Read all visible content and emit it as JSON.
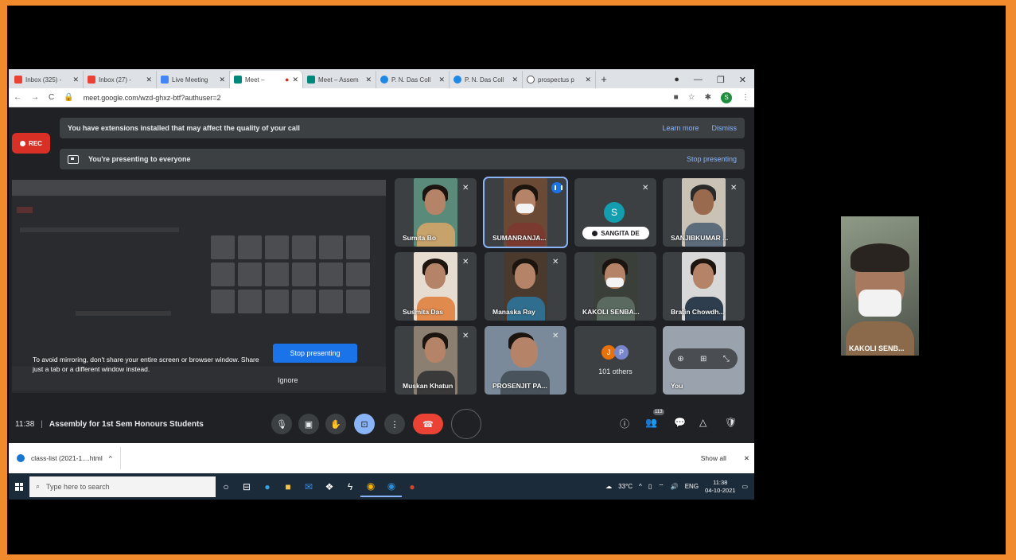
{
  "tabs": [
    {
      "label": "Inbox (325) -",
      "icon": "gmail-icon",
      "color": "#ea4335"
    },
    {
      "label": "Inbox (27) -",
      "icon": "gmail-icon",
      "color": "#ea4335"
    },
    {
      "label": "Live Meeting",
      "icon": "calendar-icon",
      "color": "#4285f4"
    },
    {
      "label": "Meet –",
      "icon": "meet-icon",
      "color": "#00897b",
      "active": true
    },
    {
      "label": "Meet – Assem",
      "icon": "meet-icon",
      "color": "#00897b"
    },
    {
      "label": "P. N. Das Coll",
      "icon": "site-icon",
      "color": "#1e88e5"
    },
    {
      "label": "P. N. Das Coll",
      "icon": "site-icon",
      "color": "#1e88e5"
    },
    {
      "label": "prospectus p",
      "icon": "globe-icon",
      "color": "#555555"
    }
  ],
  "browser": {
    "url": "meet.google.com/wzd-ghxz-btf?authuser=2",
    "profile_initial": "S"
  },
  "recording_label": "REC",
  "extension_banner": {
    "text": "You have extensions installed that may affect the quality of your call",
    "learn_more": "Learn more",
    "dismiss": "Dismiss"
  },
  "presenting_banner": {
    "text": "You're presenting to everyone",
    "stop": "Stop presenting"
  },
  "mirror_warning": {
    "text": "To avoid mirroring, don't share your entire screen or browser window. Share just a tab or a different window instead.",
    "stop_button": "Stop presenting",
    "ignore": "Ignore"
  },
  "participants": [
    {
      "name": "Sumita Bo",
      "muted": true,
      "bg": "#5a8a7a",
      "body": "#c7a26a"
    },
    {
      "name": "SUMANRANJA...",
      "active": true,
      "bg": "#6b4a35",
      "body": "#7b3a30"
    },
    {
      "name": "SANGITA DE",
      "avatar": "S"
    },
    {
      "name": "SANJIBKUMAR ...",
      "muted": true,
      "bg": "#c9c2b5",
      "body": "#5d6c7b"
    },
    {
      "name": "Susmita Das",
      "muted": true,
      "bg": "#e6ddd0",
      "body": "#e08a4e"
    },
    {
      "name": "Manaska Ray",
      "muted": true,
      "bg": "#4a3a2d",
      "body": "#2f6e8e"
    },
    {
      "name": "KAKOLI SENBA...",
      "bg": "#3a3f3a",
      "body": "#5a6a60"
    },
    {
      "name": "Bratin Chowdh...",
      "bg": "#d8d8d8",
      "body": "#2e3e4e"
    },
    {
      "name": "Muskan Khatun",
      "muted": true,
      "bg": "#8a7f70",
      "body": "#3a3a3a"
    },
    {
      "name": "PROSENJIT PA...",
      "bg": "#7a8a9a",
      "body": "#48535c"
    },
    {
      "name": "101 others",
      "avatars": [
        "J",
        "P"
      ]
    },
    {
      "name": "You"
    }
  ],
  "meeting": {
    "time": "11:38",
    "title": "Assembly for 1st Sem Honours Students",
    "people_count": "113"
  },
  "download": {
    "file": "class-list (2021-1....html",
    "show_all": "Show all"
  },
  "taskbar": {
    "search_placeholder": "Type here to search",
    "weather": "33°C",
    "lang": "ENG",
    "time": "11:38",
    "date": "04-10-2021"
  },
  "self_view": {
    "name": "KAKOLI SENB..."
  }
}
